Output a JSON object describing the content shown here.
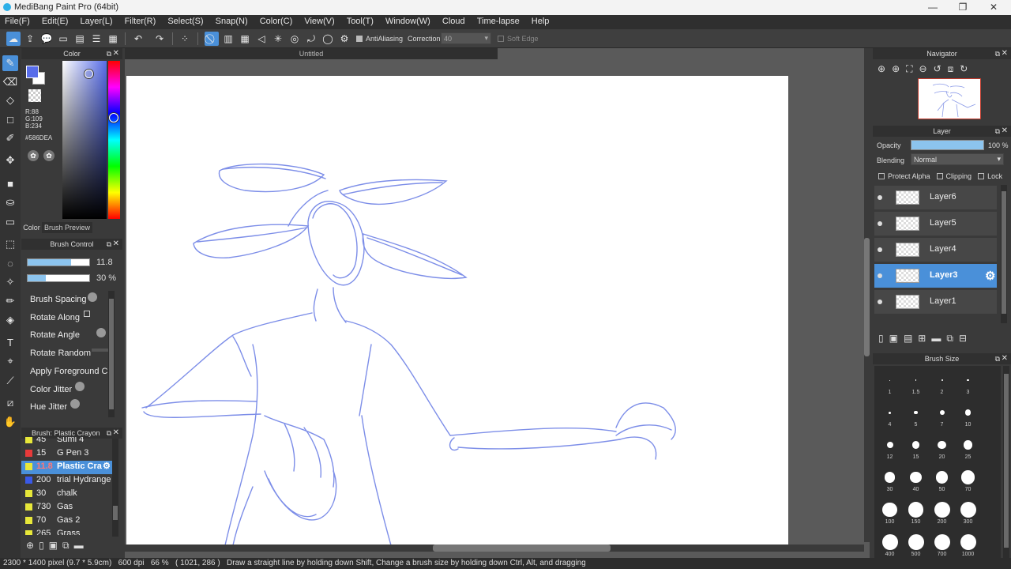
{
  "window": {
    "title": "MediBang Paint Pro (64bit)",
    "minimize": "—",
    "maximize": "❐",
    "close": "✕"
  },
  "menu": [
    "File(F)",
    "Edit(E)",
    "Layer(L)",
    "Filter(R)",
    "Select(S)",
    "Snap(N)",
    "Color(C)",
    "View(V)",
    "Tool(T)",
    "Window(W)",
    "Cloud",
    "Time-lapse",
    "Help"
  ],
  "toolbar": {
    "antialias_label": "AntiAliasing",
    "correction_label": "Correction",
    "correction_value": "40",
    "soft_edge_label": "Soft Edge"
  },
  "color_panel": {
    "title": "Color",
    "r": "R:88",
    "g": "G:109",
    "b": "B:234",
    "hex": "#586DEA",
    "tab_color": "Color",
    "tab_brush_preview": "Brush Preview",
    "fg_color": "#586DEA"
  },
  "brush_control": {
    "title": "Brush Control",
    "size_value": "11.8",
    "opacity_value": "30 %",
    "size_fill": 0.7,
    "opacity_fill": 0.3,
    "options": [
      "Brush Spacing",
      "Rotate Along",
      "Rotate Angle",
      "Rotate Random",
      "Apply Foreground Co",
      "Color Jitter",
      "Hue Jitter"
    ]
  },
  "brush_list": {
    "title": "Brush: Plastic Crayon",
    "items": [
      {
        "size": "45",
        "name": "Sumi 4",
        "color": "#e8e83a"
      },
      {
        "size": "15",
        "name": "G Pen 3",
        "color": "#e83a3a"
      },
      {
        "size": "11.8",
        "name": "Plastic Cra",
        "color": "#e8e83a",
        "selected": true
      },
      {
        "size": "200",
        "name": "trial Hydrange",
        "color": "#3a5ae8"
      },
      {
        "size": "30",
        "name": "chalk",
        "color": "#e8e83a"
      },
      {
        "size": "730",
        "name": "Gas",
        "color": "#e8e83a"
      },
      {
        "size": "70",
        "name": "Gas 2",
        "color": "#e8e83a"
      },
      {
        "size": "265",
        "name": "Grass",
        "color": "#e8e83a"
      }
    ]
  },
  "canvas": {
    "tab": "Untitled"
  },
  "navigator": {
    "title": "Navigator"
  },
  "layer_panel": {
    "title": "Layer",
    "opacity_label": "Opacity",
    "opacity_value": "100 %",
    "opacity_level": 1.0,
    "blending_label": "Blending",
    "blending_value": "Normal",
    "protect_alpha": "Protect Alpha",
    "clipping": "Clipping",
    "lock": "Lock",
    "layers": [
      {
        "name": "Layer6"
      },
      {
        "name": "Layer5"
      },
      {
        "name": "Layer4"
      },
      {
        "name": "Layer3",
        "selected": true
      },
      {
        "name": "Layer1"
      }
    ]
  },
  "brush_size": {
    "title": "Brush Size",
    "sizes": [
      "1",
      "1.5",
      "2",
      "3",
      "4",
      "5",
      "7",
      "10",
      "12",
      "15",
      "20",
      "25",
      "30",
      "40",
      "50",
      "70",
      "100",
      "150",
      "200",
      "300",
      "400",
      "500",
      "700",
      "1000"
    ]
  },
  "status": {
    "dims": "2300 * 1400 pixel",
    "cm": "(9.7 * 5.9cm)",
    "dpi": "600 dpi",
    "zoom": "66 %",
    "coords": "( 1021, 286 )",
    "hint": "Draw a straight line by holding down Shift, Change a brush size by holding down Ctrl, Alt, and dragging"
  }
}
